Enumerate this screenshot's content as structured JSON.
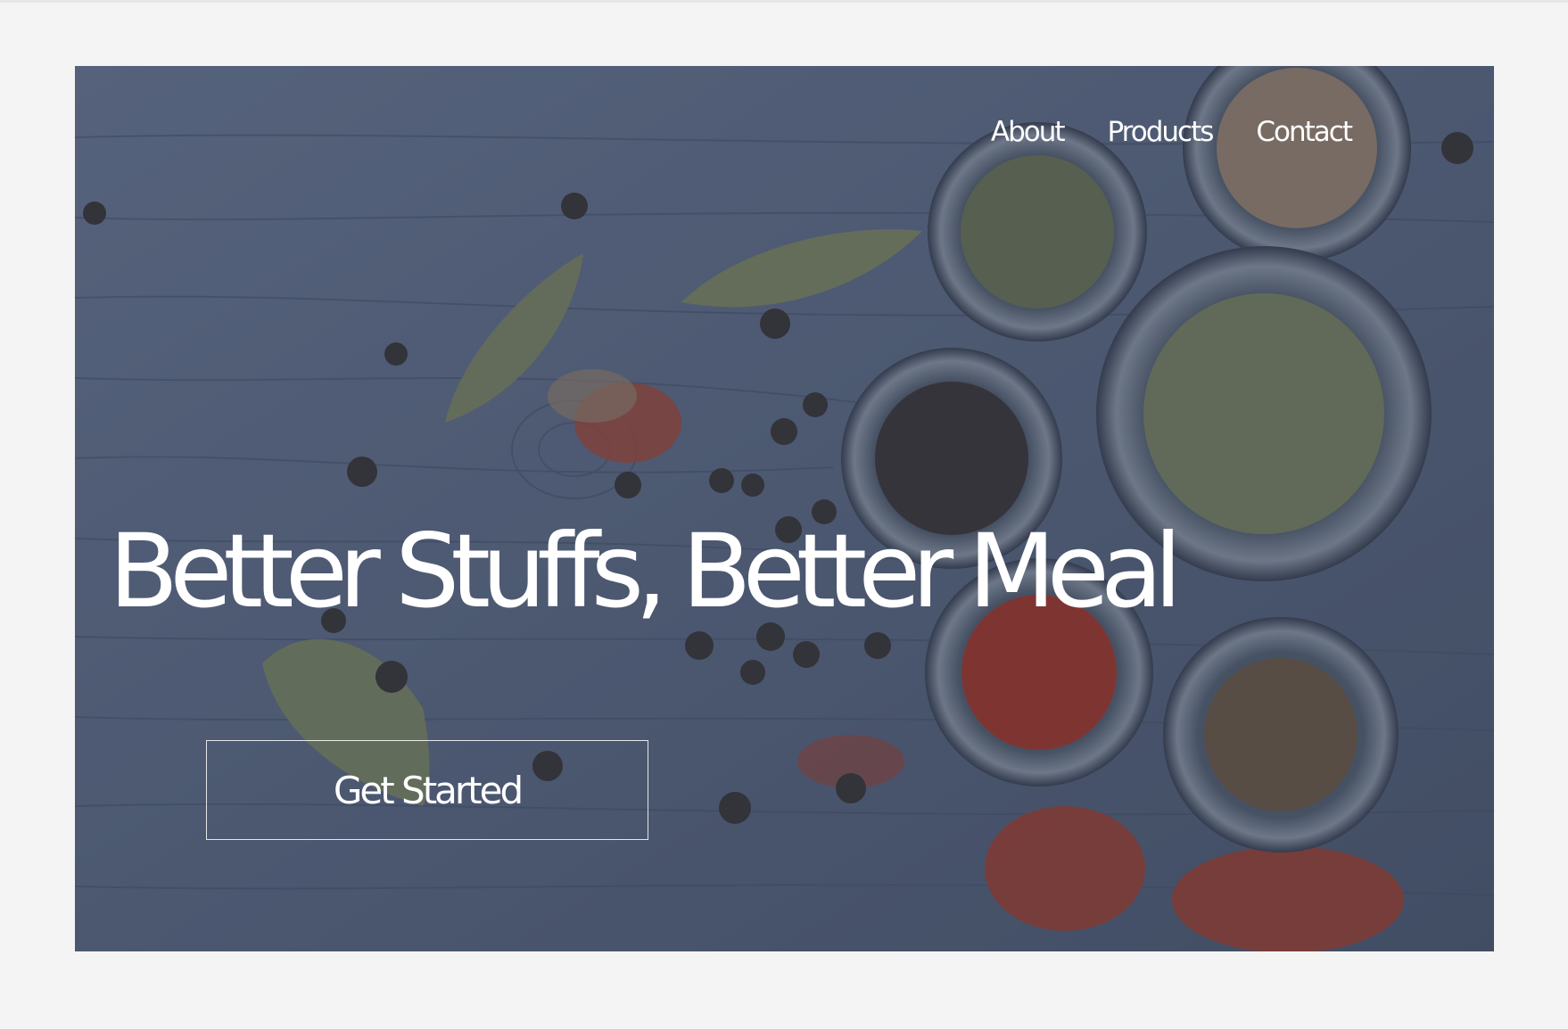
{
  "nav": {
    "items": [
      {
        "label": "About"
      },
      {
        "label": "Products"
      },
      {
        "label": "Contact"
      }
    ]
  },
  "hero": {
    "headline": "Better Stuffs, Better Meal",
    "cta_label": "Get Started"
  }
}
